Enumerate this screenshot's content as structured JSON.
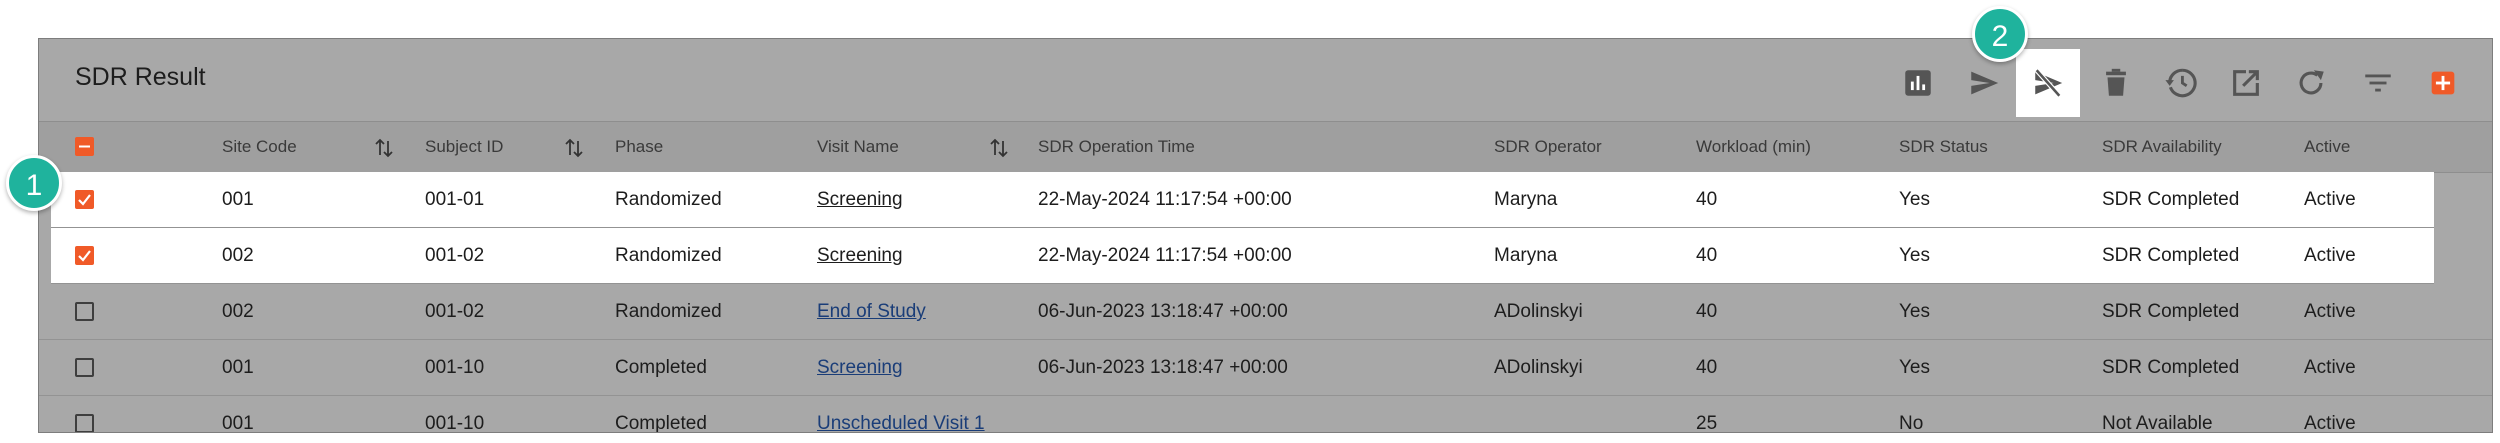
{
  "panel": {
    "title": "SDR Result"
  },
  "toolbar": {
    "icons": [
      "bar-chart-icon",
      "send-icon",
      "cancel-send-icon",
      "trash-icon",
      "history-icon",
      "open-external-icon",
      "refresh-icon",
      "filter-icon",
      "add-icon"
    ]
  },
  "callouts": {
    "first": "1",
    "second": "2"
  },
  "columns": {
    "site_code": "Site Code",
    "subject_id": "Subject ID",
    "phase": "Phase",
    "visit_name": "Visit Name",
    "op_time": "SDR Operation Time",
    "operator": "SDR Operator",
    "workload": "Workload (min)",
    "status": "SDR Status",
    "availability": "SDR Availability",
    "active": "Active"
  },
  "rows": [
    {
      "checked": true,
      "site_code": "001",
      "subject_id": "001-01",
      "phase": "Randomized",
      "visit_name": "Screening",
      "op_time": "22-May-2024 11:17:54 +00:00",
      "operator": "Maryna",
      "workload": "40",
      "status": "Yes",
      "availability": "SDR Completed",
      "active": "Active"
    },
    {
      "checked": true,
      "site_code": "002",
      "subject_id": "001-02",
      "phase": "Randomized",
      "visit_name": "Screening",
      "op_time": "22-May-2024 11:17:54 +00:00",
      "operator": "Maryna",
      "workload": "40",
      "status": "Yes",
      "availability": "SDR Completed",
      "active": "Active"
    },
    {
      "checked": false,
      "site_code": "002",
      "subject_id": "001-02",
      "phase": "Randomized",
      "visit_name": "End of Study",
      "op_time": "06-Jun-2023 13:18:47 +00:00",
      "operator": "ADolinskyi",
      "workload": "40",
      "status": "Yes",
      "availability": "SDR Completed",
      "active": "Active"
    },
    {
      "checked": false,
      "site_code": "001",
      "subject_id": "001-10",
      "phase": "Completed",
      "visit_name": "Screening",
      "op_time": "06-Jun-2023 13:18:47 +00:00",
      "operator": "ADolinskyi",
      "workload": "40",
      "status": "Yes",
      "availability": "SDR Completed",
      "active": "Active"
    },
    {
      "checked": false,
      "site_code": "001",
      "subject_id": "001-10",
      "phase": "Completed",
      "visit_name": "Unscheduled Visit 1",
      "op_time": "",
      "operator": "",
      "workload": "25",
      "status": "No",
      "availability": "Not Available",
      "active": "Active"
    }
  ],
  "colors": {
    "accent": "#f05a28",
    "callout": "#1fb39d",
    "link": "#1a3d78"
  }
}
